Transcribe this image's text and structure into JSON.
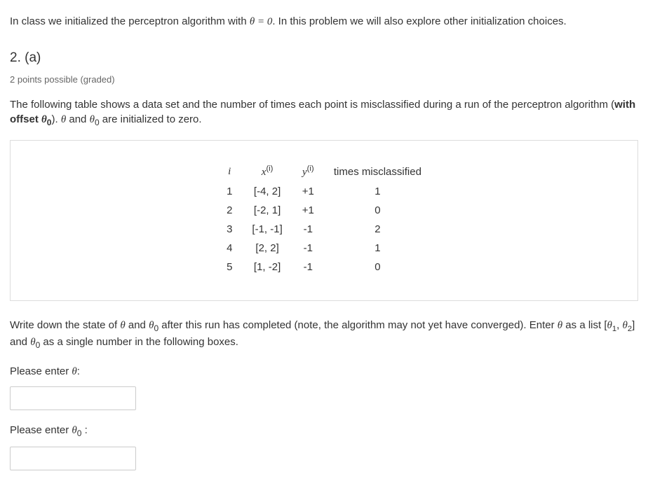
{
  "intro_pre": "In class we initialized the perceptron algorithm with ",
  "intro_math": "θ = 0",
  "intro_post": ". In this problem we will also explore other initialization choices.",
  "heading": "2. (a)",
  "points": "2 points possible (graded)",
  "desc_a": "The following table shows a data set and the number of times each point is misclassified during a run of the perceptron algorithm (",
  "desc_bold": "with offset ",
  "desc_b": "). ",
  "desc_c": " and ",
  "desc_d": " are initialized to zero.",
  "table": {
    "headers": {
      "i": "i",
      "x": "x",
      "y": "y",
      "times": "times misclassified"
    },
    "rows": [
      {
        "i": "1",
        "x": "[-4, 2]",
        "y": "+1",
        "times": "1"
      },
      {
        "i": "2",
        "x": "[-2, 1]",
        "y": "+1",
        "times": "0"
      },
      {
        "i": "3",
        "x": "[-1, -1]",
        "y": "-1",
        "times": "2"
      },
      {
        "i": "4",
        "x": "[2, 2]",
        "y": "-1",
        "times": "1"
      },
      {
        "i": "5",
        "x": "[1, -2]",
        "y": "-1",
        "times": "0"
      }
    ]
  },
  "instr_a": "Write down the state of ",
  "instr_b": " and ",
  "instr_c": " after this run has completed (note, the algorithm may not yet have converged). Enter ",
  "instr_d": " as a list ",
  "instr_list": "[θ₁, θ₂]",
  "instr_e": " and ",
  "instr_f": " as a single number in the following boxes.",
  "label_theta": "Please enter ",
  "label_theta_colon": ":",
  "label_theta0": "Please enter ",
  "label_theta0_colon": " :",
  "sym": {
    "theta": "θ",
    "theta0_sub": "0",
    "theta1_sub": "1",
    "theta2_sub": "2",
    "sup_i": "(i)"
  },
  "inputs": {
    "theta": "",
    "theta0": ""
  }
}
